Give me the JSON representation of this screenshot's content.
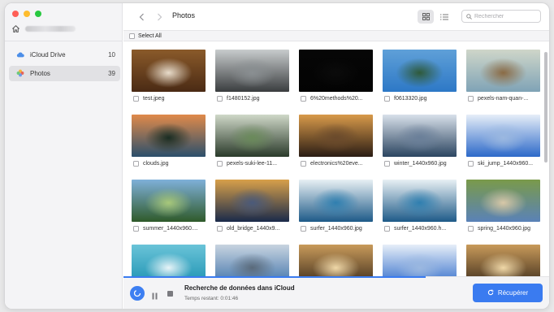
{
  "window": {
    "traffic_lights": [
      "close",
      "minimize",
      "zoom"
    ]
  },
  "sidebar": {
    "items": [
      {
        "label": "iCloud Drive",
        "count": "10",
        "icon": "cloud-icon"
      },
      {
        "label": "Photos",
        "count": "39",
        "icon": "photos-icon",
        "active": true
      }
    ]
  },
  "header": {
    "title": "Photos",
    "search_placeholder": "Rechercher"
  },
  "select_all_label": "Select All",
  "photos": [
    {
      "name": "test.jpeg",
      "palette": [
        "#4a2a14",
        "#8a5a2a",
        "#e8dccb"
      ]
    },
    {
      "name": "f1480152.jpg",
      "palette": [
        "#3a3d3f",
        "#c8cccd",
        "#8a8f92"
      ]
    },
    {
      "name": "6%20methods%20...",
      "palette": [
        "#030303",
        "#060606",
        "#0b0b0b"
      ]
    },
    {
      "name": "f0613320.jpg",
      "palette": [
        "#2d78c6",
        "#5fa0d8",
        "#2f5a3a"
      ]
    },
    {
      "name": "pexels-nam-quan-...",
      "palette": [
        "#7fa3b6",
        "#cfd6c9",
        "#8a6a44"
      ]
    },
    {
      "name": "clouds.jpg",
      "palette": [
        "#2b4f6b",
        "#e08a4a",
        "#1a2d22"
      ]
    },
    {
      "name": "pexels-suki-lee-11...",
      "palette": [
        "#2a3a2a",
        "#cfd8c8",
        "#6a8a5a"
      ]
    },
    {
      "name": "electronics%20eve...",
      "palette": [
        "#2a1c14",
        "#d89a4a",
        "#6a4a2c"
      ]
    },
    {
      "name": "winter_1440x960.jpg",
      "palette": [
        "#2b4560",
        "#d8e0ea",
        "#6a7f99"
      ]
    },
    {
      "name": "ski_jump_1440x960...",
      "palette": [
        "#2d69c9",
        "#e6eef8",
        "#9bb8e0"
      ]
    },
    {
      "name": "summer_1440x960....",
      "palette": [
        "#2f5a2a",
        "#7fb0d9",
        "#a8c87a"
      ]
    },
    {
      "name": "old_bridge_1440x9...",
      "palette": [
        "#1a2a4a",
        "#d8a04a",
        "#4a5a7a"
      ]
    },
    {
      "name": "surfer_1440x960.jpg",
      "palette": [
        "#1e5a88",
        "#e8f0f4",
        "#2f7fb0"
      ]
    },
    {
      "name": "surfer_1440x960.h...",
      "palette": [
        "#1e5a88",
        "#e8f0f4",
        "#2f7fb0"
      ]
    },
    {
      "name": "spring_1440x960.jpg",
      "palette": [
        "#5a82b8",
        "#7a9a4a",
        "#d8c8a8"
      ]
    },
    {
      "name": "",
      "palette": [
        "#1a90b0",
        "#6ac4d8",
        "#e8f4f8"
      ]
    },
    {
      "name": "",
      "palette": [
        "#3a6fa8",
        "#c8d4e0",
        "#5a6a7a"
      ]
    },
    {
      "name": "",
      "palette": [
        "#3a2a1a",
        "#c89a5a",
        "#f0d8a8"
      ]
    },
    {
      "name": "",
      "palette": [
        "#2d69c9",
        "#e6eef8",
        "#9bb8e0"
      ]
    },
    {
      "name": "",
      "palette": [
        "#3a2a1a",
        "#c89a5a",
        "#f0d8a8"
      ]
    }
  ],
  "bottom": {
    "status_title": "Recherche de données dans iCloud",
    "status_sub": "Temps restant: 0:01:46",
    "recover_label": "Récupérer",
    "progress": 0.71
  },
  "colors": {
    "accent": "#3a7bf0"
  }
}
